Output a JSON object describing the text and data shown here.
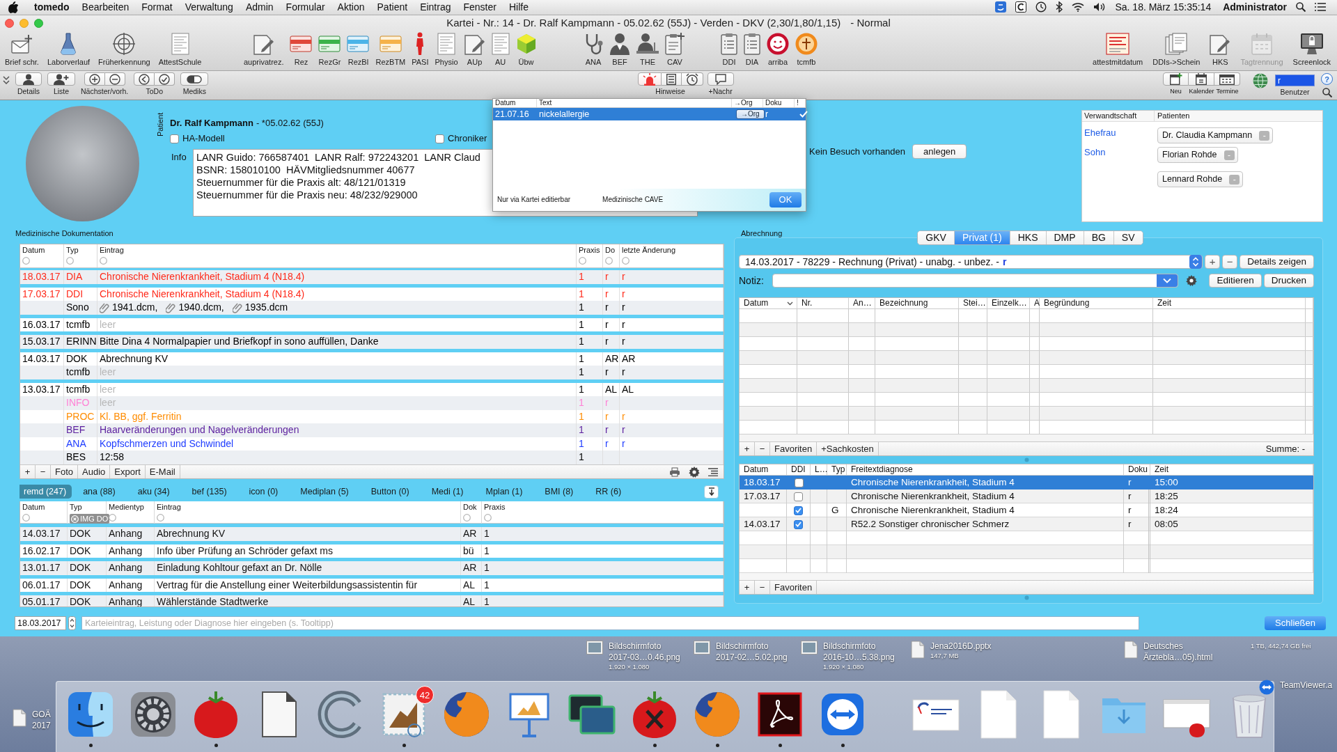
{
  "menu_bar": {
    "app": "tomedo",
    "items": [
      "Bearbeiten",
      "Format",
      "Verwaltung",
      "Admin",
      "Formular",
      "Aktion",
      "Patient",
      "Eintrag",
      "Fenster",
      "Hilfe"
    ],
    "clock": "Sa. 18. März 15:35:14",
    "user": "Administrator"
  },
  "window": {
    "title": "Kartei - Nr.: 14 - Dr. Ralf Kampmann - 05.02.62 (55J) - Verden - DKV (2,30/1,80/1,15)",
    "mode": "- Normal"
  },
  "toolbar": {
    "groups": [
      [
        {
          "label": "Brief schr.",
          "disabled": false
        },
        {
          "label": "Laborverlauf",
          "disabled": false
        },
        {
          "label": "Früherkennung",
          "disabled": false
        },
        {
          "label": "AttestSchule",
          "disabled": false
        }
      ],
      [
        {
          "label": "auprivatrez.",
          "disabled": false
        },
        {
          "label": "Rez",
          "disabled": false
        },
        {
          "label": "RezGr",
          "disabled": false
        },
        {
          "label": "RezBl",
          "disabled": false
        },
        {
          "label": "RezBTM",
          "disabled": false
        },
        {
          "label": "PASI",
          "disabled": false
        },
        {
          "label": "Physio",
          "disabled": false
        },
        {
          "label": "AUp",
          "disabled": false
        },
        {
          "label": "AU",
          "disabled": false
        },
        {
          "label": "Übw",
          "disabled": false
        }
      ],
      [
        {
          "label": "ANA",
          "disabled": false
        },
        {
          "label": "BEF",
          "disabled": false
        },
        {
          "label": "THE",
          "disabled": false
        },
        {
          "label": "CAV",
          "disabled": false
        }
      ],
      [
        {
          "label": "DDI",
          "disabled": false
        },
        {
          "label": "DIA",
          "disabled": false
        },
        {
          "label": "arriba",
          "disabled": false
        },
        {
          "label": "tcmfb",
          "disabled": false
        }
      ],
      [
        {
          "label": "attestmitdatum",
          "disabled": false
        },
        {
          "label": "DDIs->Schein",
          "disabled": false
        },
        {
          "label": "HKS",
          "disabled": false
        },
        {
          "label": "Tagtrennung",
          "disabled": true
        },
        {
          "label": "Screenlock",
          "disabled": false
        }
      ]
    ]
  },
  "toolbar2": {
    "left": [
      {
        "kind": "single",
        "label": "Details"
      },
      {
        "kind": "single",
        "label": "Liste"
      },
      {
        "kind": "pair",
        "label": "Nächster/vorh."
      },
      {
        "kind": "pair",
        "label": "ToDo"
      },
      {
        "kind": "single",
        "label": "Mediks"
      }
    ],
    "notes": {
      "label": "Hinweise",
      "segments": [
        {
          "selected": true
        },
        {
          "selected": false
        },
        {
          "selected": false
        }
      ]
    },
    "message": {
      "label": "+Nachr"
    },
    "calendar": [
      {
        "label": "Neu"
      },
      {
        "label": "Kalender"
      },
      {
        "label": "Termine"
      }
    ],
    "user": {
      "value": "r",
      "label": "Benutzer"
    },
    "help": "?"
  },
  "patient": {
    "side_label": "Patient",
    "name": "Dr. Ralf Kampmann",
    "birth": "- *05.02.62 (55J)",
    "checkboxes": [
      {
        "label": "HA-Modell",
        "checked": false
      },
      {
        "label": "Chroniker",
        "checked": false
      }
    ],
    "info_label": "Info",
    "info_lines": [
      "LANR Guido: 766587401  LANR Ralf: 972243201  LANR Claud",
      "BSNR: 158010100  HÄVMitgliedsnummer 40677",
      "Steuernummer für die Praxis alt: 48/121/01319",
      "Steuernummer für die Praxis neu: 48/232/929000"
    ],
    "visit_text": "Kein Besuch vorhanden",
    "visit_button": "anlegen"
  },
  "relatives": {
    "columns": [
      "Verwandtschaft",
      "Patienten"
    ],
    "groups": [
      {
        "relation": "Ehefrau",
        "patients": [
          {
            "name": "Dr. Claudia Kampmann",
            "button": "-"
          }
        ]
      },
      {
        "relation": "Sohn",
        "patients": [
          {
            "name": "Florian Rohde",
            "button": "-"
          },
          {
            "name": "Lennard Rohde",
            "button": "-"
          }
        ]
      }
    ]
  },
  "cave_popup": {
    "columns": [
      "Datum",
      "Text",
      "→Org",
      "Doku",
      "!"
    ],
    "rows": [
      {
        "date": "21.07.16",
        "text": "nickelallergie",
        "org": "→Org",
        "doku": "r",
        "important": true,
        "selected": true
      }
    ],
    "footer_note": "Nur via Kartei editierbar",
    "footer_title": "Medizinische CAVE",
    "ok": "OK"
  },
  "documentation": {
    "title": "Medizinische Dokumentation",
    "columns": [
      "Datum",
      "Typ",
      "Eintrag",
      "Praxis",
      "Do",
      "letzte Änderung"
    ],
    "groups": [
      {
        "date": "18.03.17",
        "entries": [
          {
            "kind": "text",
            "type": "DIA",
            "text": "Chronische Nierenkrankheit, Stadium 4 (N18.4)",
            "praxis": "1",
            "do": "r",
            "changed": "r",
            "color": "#ff2a1a",
            "muted": false
          }
        ]
      },
      {
        "date": "17.03.17",
        "entries": [
          {
            "kind": "text",
            "type": "DDI",
            "text": "Chronische Nierenkrankheit, Stadium 4 (N18.4)",
            "praxis": "1",
            "do": "r",
            "changed": "r",
            "color": "#ff2a1a",
            "muted": false
          },
          {
            "kind": "attachments",
            "type": "Sono",
            "attachments": [
              "1941.dcm,",
              "1940.dcm,",
              "1935.dcm"
            ],
            "praxis": "1",
            "do": "r",
            "changed": "r",
            "color": "#000000",
            "muted": false
          }
        ]
      },
      {
        "date": "16.03.17",
        "entries": [
          {
            "kind": "text",
            "type": "tcmfb",
            "text": "leer",
            "praxis": "1",
            "do": "r",
            "changed": "r",
            "color": "#000000",
            "muted": true
          }
        ]
      },
      {
        "date": "15.03.17",
        "entries": [
          {
            "kind": "text",
            "type": "ERINN",
            "text": "Bitte Dina 4 Normalpapier und Briefkopf in sono auffüllen, Danke",
            "praxis": "1",
            "do": "r",
            "changed": "r",
            "color": "#000000",
            "muted": false
          }
        ]
      },
      {
        "date": "14.03.17",
        "entries": [
          {
            "kind": "text",
            "type": "DOK",
            "text": "Abrechnung KV",
            "praxis": "1",
            "do": "AR",
            "changed": "AR",
            "color": "#000000",
            "muted": false
          },
          {
            "kind": "text",
            "type": "tcmfb",
            "text": "leer",
            "praxis": "1",
            "do": "r",
            "changed": "r",
            "color": "#000000",
            "muted": true
          }
        ]
      },
      {
        "date": "13.03.17",
        "entries": [
          {
            "kind": "text",
            "type": "tcmfb",
            "text": "leer",
            "praxis": "1",
            "do": "AL",
            "changed": "AL",
            "color": "#000000",
            "muted": true
          },
          {
            "kind": "text",
            "type": "INFO",
            "text": "leer",
            "praxis": "1",
            "do": "r",
            "color": "#ff80d5",
            "muted": true
          },
          {
            "kind": "text",
            "type": "PROC",
            "text": "Kl. BB, ggf. Ferritin",
            "praxis": "1",
            "do": "r",
            "changed": "r",
            "color": "#ff8c00",
            "muted": false
          },
          {
            "kind": "text",
            "type": "BEF",
            "text": "Haarveränderungen und Nagelveränderungen",
            "praxis": "1",
            "do": "r",
            "changed": "r",
            "color": "#5b1f9e",
            "muted": false
          },
          {
            "kind": "text",
            "type": "ANA",
            "text": "Kopfschmerzen und Schwindel",
            "praxis": "1",
            "do": "r",
            "changed": "r",
            "color": "#1e3cff",
            "muted": false
          },
          {
            "kind": "text",
            "type": "BES",
            "text": "12:58",
            "praxis": "1",
            "color": "#000000",
            "muted": false
          }
        ]
      }
    ],
    "footer_buttons": [
      "+",
      "−",
      "Foto",
      "Audio",
      "Export",
      "E-Mail"
    ]
  },
  "filter_tabs": [
    {
      "label": "remd (247)",
      "selected": true
    },
    {
      "label": "ana (88)",
      "selected": false
    },
    {
      "label": "aku (34)",
      "selected": false
    },
    {
      "label": "bef (135)",
      "selected": false
    },
    {
      "label": "icon (0)",
      "selected": false
    },
    {
      "label": "Mediplan (5)",
      "selected": false
    },
    {
      "label": "Button (0)",
      "selected": false
    },
    {
      "label": "Medi (1)",
      "selected": false
    },
    {
      "label": "Mplan (1)",
      "selected": false
    },
    {
      "label": "BMI (8)",
      "selected": false
    },
    {
      "label": "RR (6)",
      "selected": false
    }
  ],
  "attachments_table": {
    "columns": [
      "Datum",
      "Typ",
      "Medientyp",
      "Eintrag",
      "Dok",
      "Praxis"
    ],
    "filter_token": "IMG DO",
    "rows": [
      {
        "date": "14.03.17",
        "type": "DOK",
        "media": "Anhang",
        "text": "Abrechnung KV",
        "dok": "AR",
        "praxis": "1"
      },
      {
        "date": "16.02.17",
        "type": "DOK",
        "media": "Anhang",
        "text": "Info über Prüfung an Schröder gefaxt ms",
        "dok": "bü",
        "praxis": "1"
      },
      {
        "date": "13.01.17",
        "type": "DOK",
        "media": "Anhang",
        "text": "Einladung Kohltour gefaxt an Dr. Nölle",
        "dok": "AR",
        "praxis": "1"
      },
      {
        "date": "06.01.17",
        "type": "DOK",
        "media": "Anhang",
        "text": "Vertrag für die Anstellung einer Weiterbildungsassistentin für",
        "dok": "AL",
        "praxis": "1"
      },
      {
        "date": "05.01.17",
        "type": "DOK",
        "media": "Anhang",
        "text": "Wählerstände Stadtwerke",
        "dok": "AL",
        "praxis": "1"
      }
    ]
  },
  "billing": {
    "title": "Abrechnung",
    "tabs": [
      {
        "label": "GKV",
        "selected": false
      },
      {
        "label": "Privat (1)",
        "selected": true
      },
      {
        "label": "HKS",
        "selected": false
      },
      {
        "label": "DMP",
        "selected": false
      },
      {
        "label": "BG",
        "selected": false
      },
      {
        "label": "SV",
        "selected": false
      }
    ],
    "invoice": {
      "text": "14.03.2017 - 78229 - Rechnung (Privat) - unabg. - unbez. -",
      "user": "r"
    },
    "invoice_buttons": [
      "+",
      "−"
    ],
    "details_button": "Details zeigen",
    "note_label": "Notiz:",
    "edit_button": "Editieren",
    "print_button": "Drucken",
    "services": {
      "columns": [
        "Datum",
        "Nr.",
        "An…",
        "Bezeichnung",
        "Stei…",
        "Einzelk…",
        "A",
        "Begründung",
        "Zeit"
      ],
      "footer_buttons": [
        "+",
        "−",
        "Favoriten",
        "+Sachkosten"
      ],
      "sum": "Summe: -"
    },
    "diagnoses": {
      "columns": [
        "Datum",
        "DDI",
        "L…",
        "Typ",
        "Freitextdiagnose",
        "Doku",
        "Zeit"
      ],
      "rows": [
        {
          "date": "18.03.17",
          "ddi": false,
          "text": "Chronische Nierenkrankheit, Stadium 4",
          "doku": "r",
          "time": "15:00",
          "selected": true
        },
        {
          "date": "17.03.17",
          "ddi": false,
          "text": "Chronische Nierenkrankheit, Stadium 4",
          "doku": "r",
          "time": "18:25",
          "selected": false
        },
        {
          "ddi": true,
          "type": "G",
          "text": "Chronische Nierenkrankheit, Stadium 4",
          "doku": "r",
          "time": "18:24",
          "selected": false
        },
        {
          "date": "14.03.17",
          "ddi": true,
          "text": "R52.2 Sonstiger chronischer Schmerz",
          "doku": "r",
          "time": "08:05",
          "selected": false
        }
      ],
      "footer_buttons": [
        "+",
        "−",
        "Favoriten"
      ]
    }
  },
  "entry_bar": {
    "date": "18.03.2017",
    "placeholder": "Karteieintrag, Leistung oder Diagnose hier eingeben (s. Tooltipp)",
    "close_button": "Schließen"
  },
  "desktop": {
    "files": [
      {
        "lines": [
          "Bildschirmfoto",
          "2017-03…0.46.png"
        ],
        "meta": "1.920 × 1.080"
      },
      {
        "lines": [
          "Bildschirmfoto",
          "2017-02…5.02.png"
        ]
      },
      {
        "lines": [
          "Bildschirmfoto",
          "2016-10…5.38.png"
        ],
        "meta": "1.920 × 1.080"
      },
      {
        "lines": [
          "Jena2016D.pptx"
        ],
        "meta": "147,7 MB"
      },
      {
        "lines": [
          "Deutsches",
          "Ärztebla…05).html"
        ]
      },
      {
        "lines": [
          "GOÄ",
          "2017"
        ]
      },
      {
        "lines": [
          "TeamViewer.a"
        ]
      }
    ],
    "disk": "1 TB, 442,74 GB frei"
  },
  "dock": {
    "items": [
      {
        "running": true
      },
      {
        "running": false
      },
      {
        "running": true
      },
      {
        "running": false
      },
      {
        "running": false
      },
      {
        "running": true,
        "badge": "42"
      },
      {
        "running": false
      },
      {
        "running": false
      },
      {
        "running": false
      },
      {
        "running": true
      },
      {
        "running": true
      },
      {
        "running": true
      },
      {
        "running": true
      },
      {
        "running": false
      },
      {
        "running": false
      },
      {
        "running": false
      },
      {
        "running": false
      },
      {
        "running": false
      },
      {
        "running": false
      }
    ]
  }
}
